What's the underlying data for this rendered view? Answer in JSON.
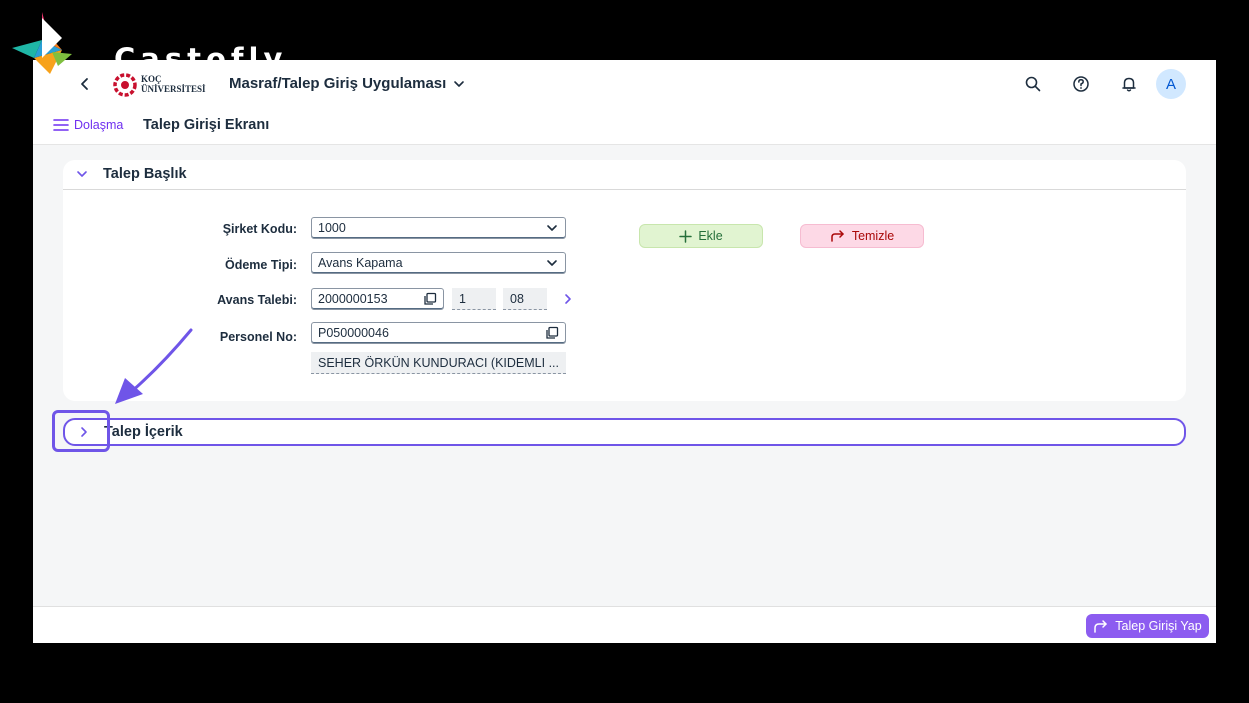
{
  "brand": {
    "name": "Castofly"
  },
  "shellbar": {
    "logo_line1": "KOÇ",
    "logo_line2": "ÜNİVERSİTESİ",
    "app_title": "Masraf/Talep Giriş Uygulaması",
    "avatar_initial": "A"
  },
  "subheader": {
    "nav_label": "Dolaşma",
    "page_title": "Talep Girişi Ekranı"
  },
  "talep_baslik": {
    "title": "Talep Başlık",
    "sirket_kodu": {
      "label": "Şirket Kodu:",
      "value": "1000"
    },
    "odeme_tipi": {
      "label": "Ödeme Tipi:",
      "value": "Avans Kapama"
    },
    "avans_talebi": {
      "label": "Avans Talebi:",
      "value": "2000000153",
      "item": "1",
      "month": "08"
    },
    "personel_no": {
      "label": "Personel No:",
      "value": "P050000046",
      "name": "SEHER ÖRKÜN KUNDURACI (KIDEMLI ..."
    },
    "buttons": {
      "ekle": "Ekle",
      "temizle": "Temizle"
    }
  },
  "talep_icerik": {
    "title": "Talep İçerik"
  },
  "footer": {
    "submit_label": "Talep Girişi Yap"
  },
  "colors": {
    "accent": "#6f55e8",
    "nav_purple": "#6f2ff0",
    "submit_bg": "#8c5cf0",
    "ekle_bg": "#e1f4d1",
    "temizle_bg": "#fdd9e6",
    "koc_red": "#c8102e"
  }
}
